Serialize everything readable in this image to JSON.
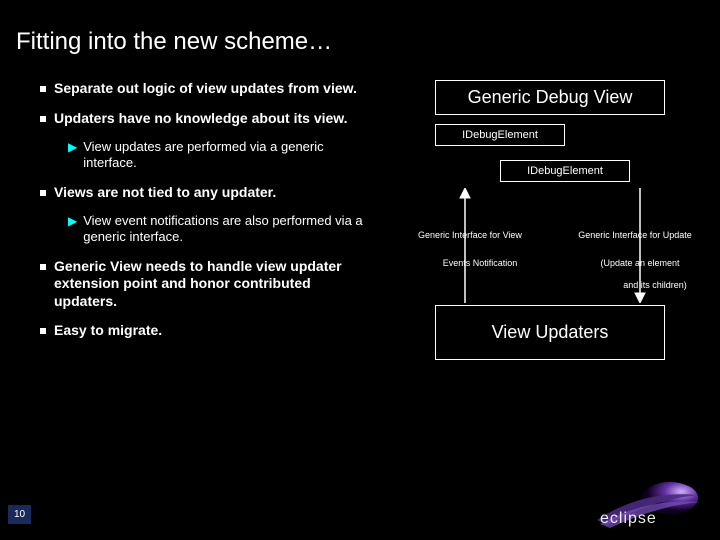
{
  "title": "Fitting into the new scheme…",
  "bullets": {
    "b1": "Separate out logic of view updates from view.",
    "b2": "Updaters have no knowledge about its view.",
    "b2s": "View updates are performed via a generic interface.",
    "b3": "Views are not tied to any updater.",
    "b3s": "View event notifications are also performed via a generic interface.",
    "b4": "Generic View needs to handle view updater extension point and honor contributed updaters.",
    "b5": "Easy to migrate."
  },
  "diagram": {
    "genericView": "Generic Debug View",
    "idebug1": "IDebugElement",
    "idebug2": "IDebugElement",
    "giView": "Generic Interface for View",
    "giUpdate": "Generic Interface for Update",
    "events": "Events Notification",
    "updateElem": "(Update an element",
    "children": "and its children)",
    "updaters": "View Updaters"
  },
  "page": "10",
  "logo": "eclipse"
}
